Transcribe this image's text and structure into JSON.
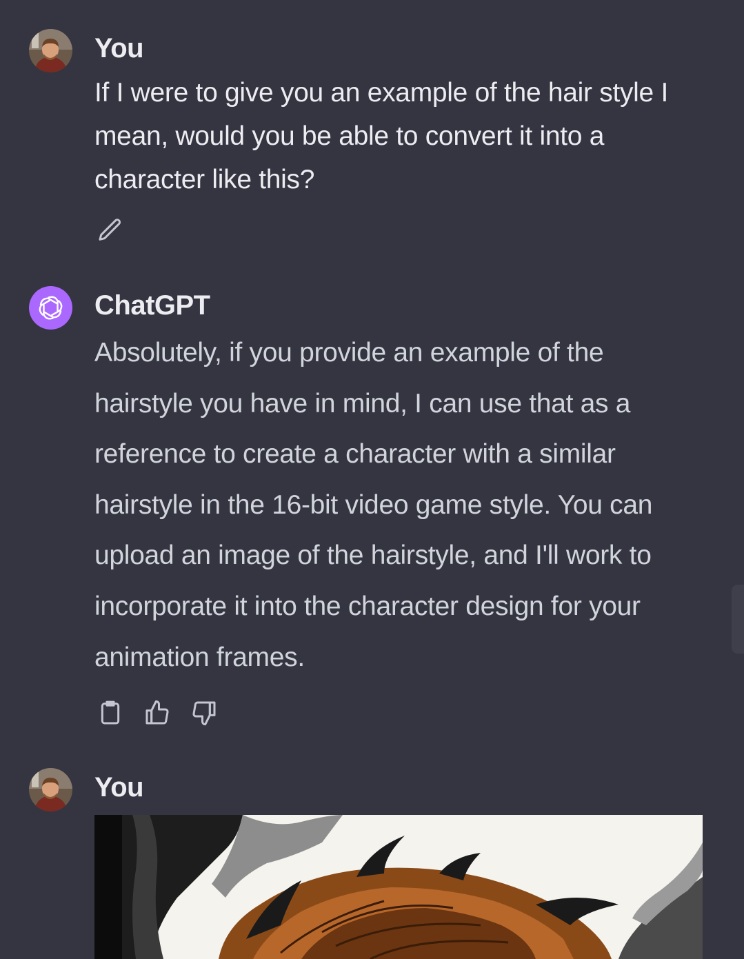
{
  "messages": [
    {
      "author": "You",
      "text": "If I were to give you an example of the hair style I mean, would you be able to convert it into a character like this?",
      "actions": [
        "pencil-icon"
      ]
    },
    {
      "author": "ChatGPT",
      "text": "Absolutely, if you provide an example of the hairstyle you have in mind, I can use that as a reference to create a character with a similar hairstyle in the 16-bit video game style. You can upload an image of the hairstyle, and I'll work to incorporate it into the character design for your animation frames.",
      "actions": [
        "clipboard-icon",
        "thumbs-up-icon",
        "thumbs-down-icon"
      ]
    },
    {
      "author": "You",
      "attachment": "uploaded-image"
    }
  ],
  "colors": {
    "background": "#343541",
    "text_primary": "#ececf1",
    "text_assistant": "#d1d5db",
    "assistant_avatar": "#ab68ff",
    "icon": "#c5c5d2"
  }
}
